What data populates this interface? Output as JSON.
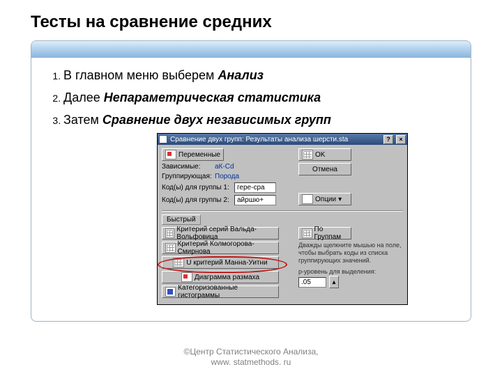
{
  "title": "Тесты на сравнение средних",
  "steps": [
    {
      "pre": "В главном меню выберем ",
      "em": "Анализ"
    },
    {
      "pre": "Далее ",
      "em": "Непараметрическая статистика"
    },
    {
      "pre": "Затем ",
      "em": "Сравнение двух независимых групп"
    }
  ],
  "dialog": {
    "title": "Сравнение двух групп: Результаты анализа шерсти.sta",
    "vars_btn": "Переменные",
    "dependent_lbl": "Зависимые:",
    "dependent_val": "аК-Cd",
    "grouping_lbl": "Группирующая:",
    "grouping_val": "Порода",
    "code1_lbl": "Код(ы) для группы 1:",
    "code1_val": "гере-сра",
    "code2_lbl": "Код(ы) для группы 2:",
    "code2_val": "айршю+",
    "quick_lbl": "Быстрый",
    "test1": "Критерий серий Вальда-Вольфовица",
    "test2": "Критерий Колмогорова-Смирнова",
    "test3": "U критерий Манна-Уитни",
    "test4": "Диаграмма размаха",
    "test5": "Категоризованные гистограммы",
    "ok": "OK",
    "cancel": "Отмена",
    "options": "Опции",
    "by_groups": "По Группам",
    "hint1": "Дважды щелкните мышью на поле, чтобы выбрать коды из списка группирующих значений.",
    "hint2_lbl": "p-уровень для выделения:",
    "hint2_val": ".05"
  },
  "footer1": "©Центр Статистического Анализа,",
  "footer2": "www. statmethods. ru"
}
